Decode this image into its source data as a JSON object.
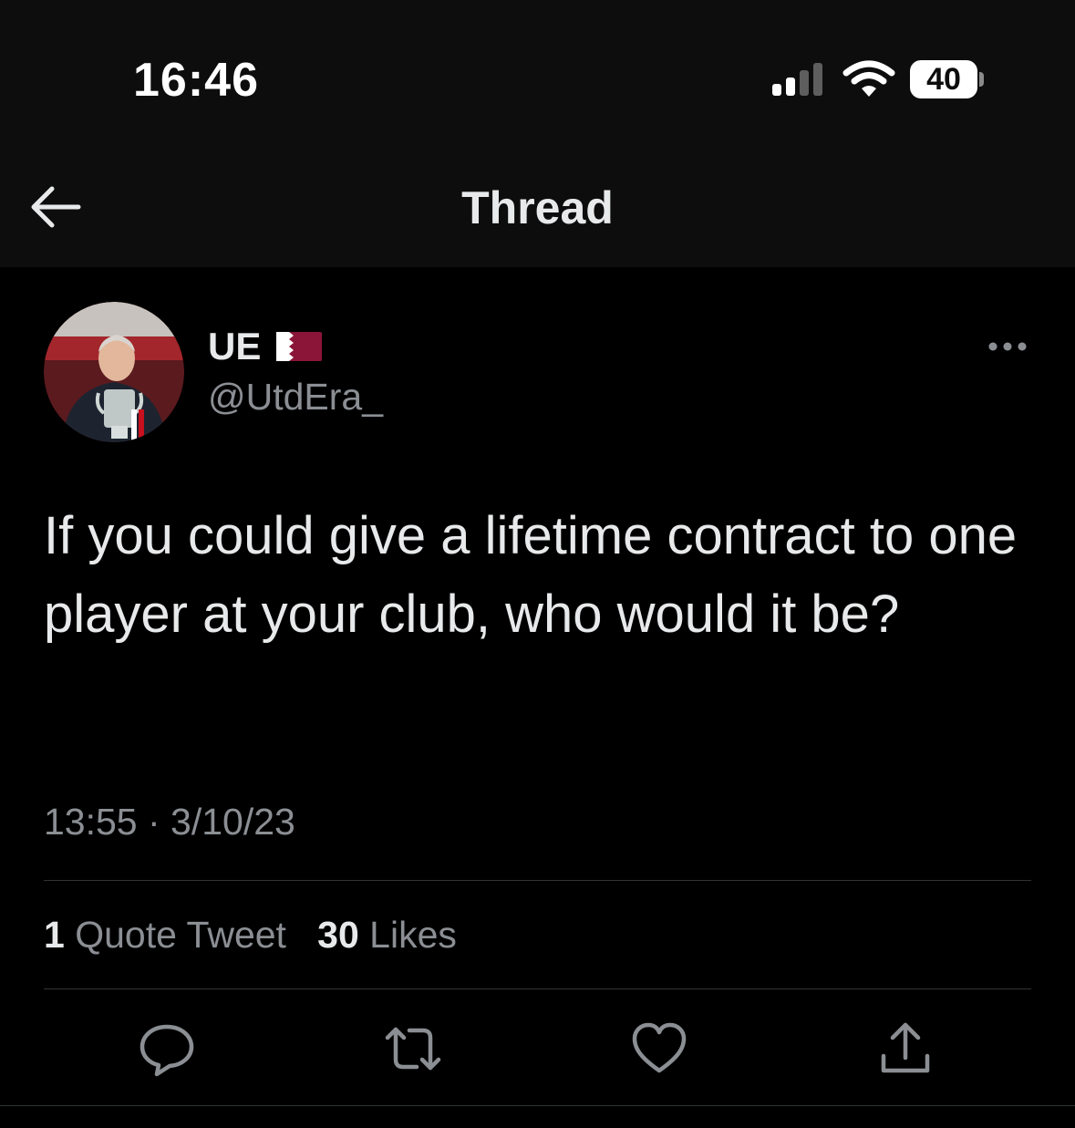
{
  "status_bar": {
    "time": "16:46",
    "battery": "40",
    "signal_icon": "cellular-signal-icon",
    "wifi_icon": "wifi-icon"
  },
  "header": {
    "title": "Thread",
    "back_icon": "arrow-left-icon"
  },
  "tweet": {
    "display_name": "UE",
    "flag_icon": "qatar-flag-icon",
    "handle": "@UtdEra_",
    "text": "If you could give a lifetime contract to one player at your club, who would it be?",
    "timestamp": "13:55 · 3/10/23",
    "more_icon": "more-options-icon"
  },
  "stats": {
    "quotes_count": "1",
    "quotes_label": "Quote Tweet",
    "likes_count": "30",
    "likes_label": "Likes"
  },
  "actions": [
    {
      "icon": "reply-icon"
    },
    {
      "icon": "retweet-icon"
    },
    {
      "icon": "like-icon"
    },
    {
      "icon": "share-icon"
    }
  ],
  "colors": {
    "background": "#000000",
    "header_background": "#0d0d0d",
    "primary_text": "#e7e9ea",
    "secondary_text": "#8b8f94",
    "divider": "#2f3336",
    "flag": "#8a1538"
  }
}
